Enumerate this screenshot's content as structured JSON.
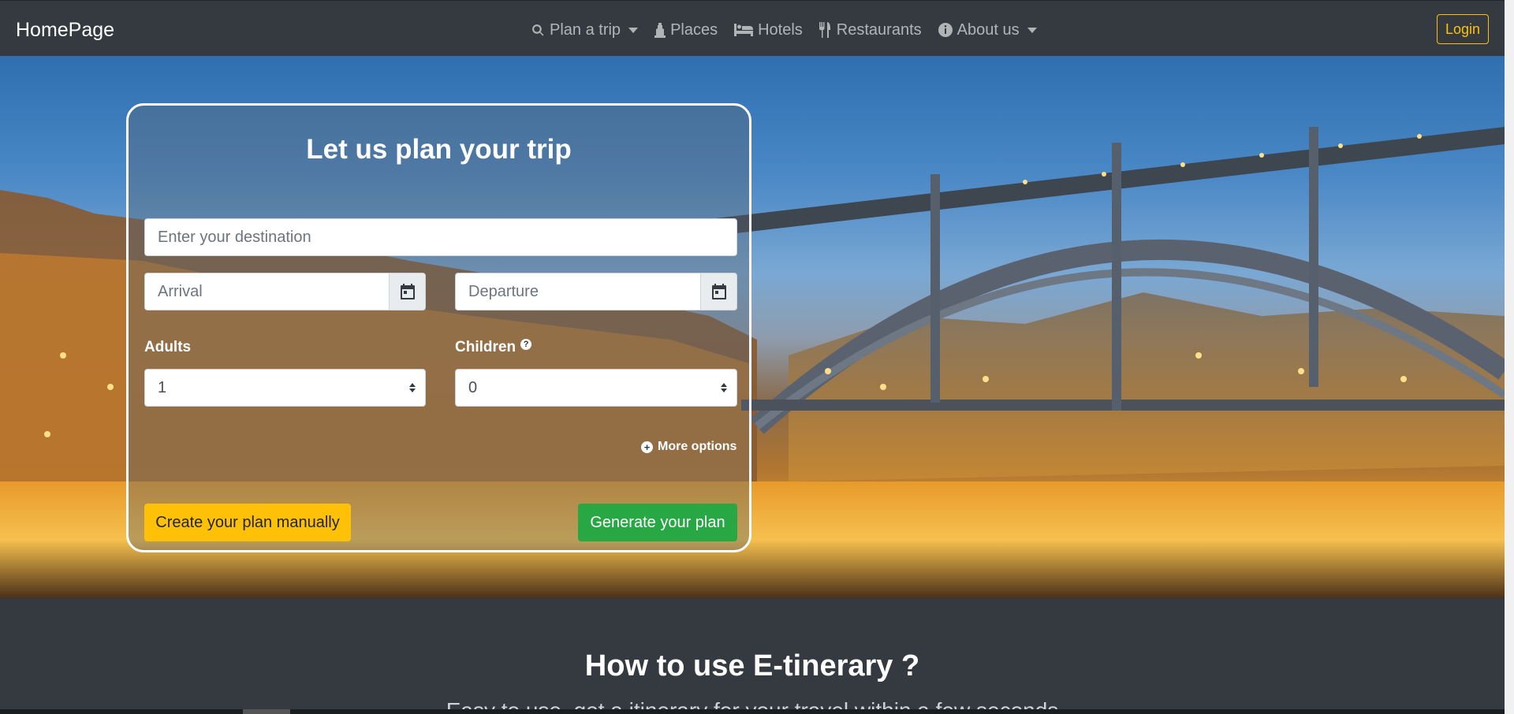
{
  "navbar": {
    "brand": "HomePage",
    "items": [
      {
        "label": "Plan a trip",
        "icon": "search-icon",
        "dropdown": true
      },
      {
        "label": "Places",
        "icon": "landmark-icon",
        "dropdown": false
      },
      {
        "label": "Hotels",
        "icon": "bed-icon",
        "dropdown": false
      },
      {
        "label": "Restaurants",
        "icon": "utensils-icon",
        "dropdown": false
      },
      {
        "label": "About us",
        "icon": "info-circle-icon",
        "dropdown": true
      }
    ],
    "login_label": "Login"
  },
  "hero": {
    "background": "night-photo of city riverside with illuminated steel arch bridge"
  },
  "plan_form": {
    "title": "Let us plan your trip",
    "destination_placeholder": "Enter your destination",
    "arrival_placeholder": "Arrival",
    "departure_placeholder": "Departure",
    "adults_label": "Adults",
    "adults_value": "1",
    "children_label": "Children",
    "children_value": "0",
    "more_options_label": "More options",
    "create_manual_label": "Create your plan manually",
    "generate_label": "Generate your plan"
  },
  "howto": {
    "title": "How to use E-tinerary ?",
    "subtitle": "Easy to use, get a itinerary for your travel within a few seconds"
  },
  "colors": {
    "navbar_bg": "#343a40",
    "warning": "#ffc107",
    "success": "#28a745"
  }
}
